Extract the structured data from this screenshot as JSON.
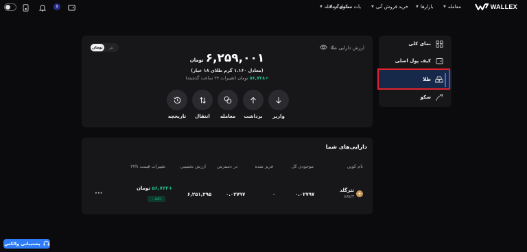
{
  "brand": {
    "logo": "WALLEX"
  },
  "nav": {
    "items": [
      {
        "label": "معامله"
      },
      {
        "label": "بازارها"
      },
      {
        "label": "خرید فروش آنی"
      },
      {
        "label": "بات معامله‌گر"
      },
      {
        "label": "سکوی معامله"
      }
    ],
    "icons": [
      "wallet-icon",
      "profile-badge-icon",
      "bell-icon",
      "device-icon",
      "theme-toggle"
    ],
    "profile_badge": "I"
  },
  "sidebar": {
    "items": [
      {
        "label": "نمای کلی",
        "icon": "grid-icon"
      },
      {
        "label": "کیف پول اصلی",
        "icon": "wallet-icon"
      },
      {
        "label": "طلا",
        "icon": "gold-bars-icon",
        "active": true
      },
      {
        "label": "سکو",
        "icon": "growth-icon"
      }
    ]
  },
  "summary": {
    "title": "ارزش دارایی طلا",
    "currency_toggle": {
      "options": [
        "تتر",
        "تومان"
      ],
      "selected": "تومان"
    },
    "value": "۶,۲۵۹,۰۰۱",
    "value_unit": "تومان",
    "equivalent": "(معادل ۱.۱۶۰ گرم طلای ۱۸ عیار)",
    "change_value": "+۵۶,۷۲۸",
    "change_label": "تومان (تغییرات ۲۴ ساعت گذشته)",
    "actions": [
      {
        "label": "واریز",
        "icon": "arrow-down-icon"
      },
      {
        "label": "برداشت",
        "icon": "arrow-up-icon"
      },
      {
        "label": "معامله",
        "icon": "swap-icon"
      },
      {
        "label": "انتقال",
        "icon": "transfer-icon"
      },
      {
        "label": "تاریخچه",
        "icon": "history-icon"
      }
    ]
  },
  "assets": {
    "title": "دارایی‌های شما",
    "columns": [
      "نام کوین",
      "موجودی کل",
      "فریز شده",
      "در دسترس",
      "ارزش تخمینی",
      "تغییرات قیمت ۲۴h"
    ],
    "rows": [
      {
        "name": "تترگلد",
        "symbol": "XAUT",
        "total": "۰.۰۲۷۹۷",
        "frozen": "۰",
        "available": "۰.۰۲۷۹۷",
        "estimated_value": "۶,۲۵۱,۲۹۵",
        "change_amount": "+۵۶,۷۶۳",
        "change_unit": "تومان",
        "change_percent": "۰.۸۸٪",
        "more": "•••"
      }
    ]
  },
  "support": {
    "label": "پشتیبانی والکس"
  },
  "colors": {
    "accent": "#2f7cf6",
    "positive": "#22c08b",
    "highlight": "#e3232b",
    "card": "#17171a",
    "bg": "#0b0b0d"
  }
}
